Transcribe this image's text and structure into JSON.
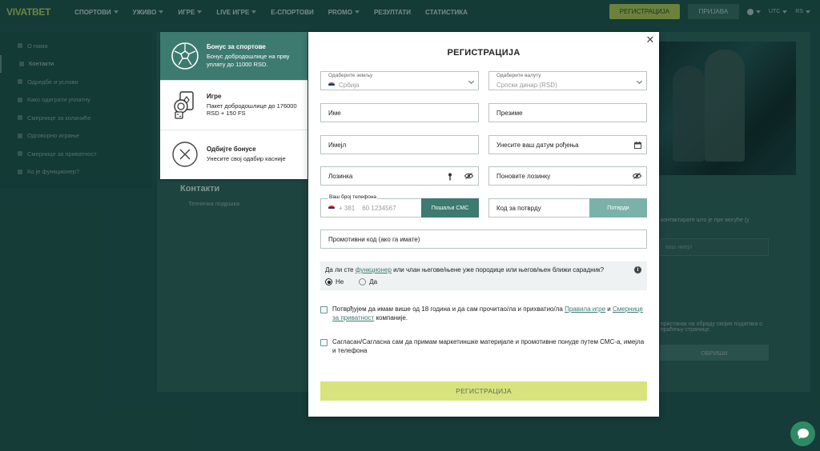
{
  "colors": {
    "accent": "#3d7a70",
    "brand_green": "#9fb54c",
    "submit": "#d8e37e",
    "page_bg": "#1c4a45"
  },
  "header": {
    "logo": "VIVATBET",
    "nav": [
      {
        "label": "СПОРТОВИ",
        "caret": true
      },
      {
        "label": "УЖИВО",
        "caret": true
      },
      {
        "label": "ИГРЕ",
        "caret": true
      },
      {
        "label": "LIVE ИГРЕ",
        "caret": true
      },
      {
        "label": "Е-СПОРТОВИ",
        "caret": false
      },
      {
        "label": "PROMO",
        "caret": true
      },
      {
        "label": "РЕЗУЛТАТИ",
        "caret": false
      },
      {
        "label": "СТАТИСТИКА",
        "caret": false
      }
    ],
    "register_label": "РЕГИСТРАЦИЈА",
    "login_label": "ПРИЈАВА",
    "timezone": "UTC",
    "language": "RS"
  },
  "sidebar": {
    "items": [
      {
        "label": "О нама",
        "active": false
      },
      {
        "label": "Контакти",
        "active": true
      },
      {
        "label": "Одредбе и услови",
        "active": false
      },
      {
        "label": "Како одиграти уплатну",
        "active": false
      },
      {
        "label": "Смернице за колачиће",
        "active": false
      },
      {
        "label": "Одговорно играње",
        "active": false
      },
      {
        "label": "Смернице за приватност",
        "active": false
      },
      {
        "label": "Ко је функционер?",
        "active": false
      }
    ]
  },
  "background": {
    "contacts_title": "Контакти",
    "contacts_sub": "Техничка подршка",
    "side_text_1": "контактирате што је пре могуће (у",
    "side_input_placeholder": "ваш имејл",
    "side_text_2": "пристанак на обраду својих података о праћењу странице.",
    "side_button": "ОБРИШИ"
  },
  "bonuses": [
    {
      "icon": "soccer-ball-icon",
      "title": "Бонус за спортове",
      "desc": "Бонус добродошлице на прву уплату до 11000 RSD.",
      "selected": true
    },
    {
      "icon": "casino-chips-icon",
      "title": "Игре",
      "desc": "Пакет добродошлице до 176000 RSD + 150 FS",
      "selected": false
    },
    {
      "icon": "decline-x-icon",
      "title": "Одбијте бонусе",
      "desc": "Унесите свој одабир касније",
      "selected": false
    }
  ],
  "form": {
    "title": "РЕГИСТРАЦИЈА",
    "country_label": "Одаберите земљу",
    "country_value": "Србија",
    "currency_label": "Одаберите валуту",
    "currency_value": "Српски динар (RSD)",
    "first_name": "Име",
    "last_name": "Презиме",
    "email": "Имејл",
    "birthdate": "Унесите ваш датум рођења",
    "password": "Лозинка",
    "password_repeat": "Поновите лозинку",
    "phone_label": "Ваш број телефона",
    "phone_code": "+ 381",
    "phone_placeholder": "60 1234567",
    "send_sms": "Пошаљи СМС",
    "confirm_code": "Код за потврду",
    "confirm_btn": "Потврди",
    "promo_code": "Промотивни код (ако га имате)",
    "question_pre": "Да ли сте ",
    "question_link": "функционер",
    "question_post": " или члан његове/њене уже породице или његов/њен ближи сарадник?",
    "answer_no": "Не",
    "answer_yes": "Да",
    "answer_selected": "no",
    "terms_pre": "Потврђујем да имам више од 18 година и да сам прочитао/ла и прихватио/ла ",
    "terms_link1": "Правила игре",
    "terms_mid": " и ",
    "terms_link2": "Смернице за приватност",
    "terms_post": " компаније.",
    "marketing": "Сагласан/Сагласна сам да примам маркетиншке материјале и промотивне понуде путем СМС-а, имејла и телефона",
    "submit": "РЕГИСТРАЦИЈА"
  }
}
